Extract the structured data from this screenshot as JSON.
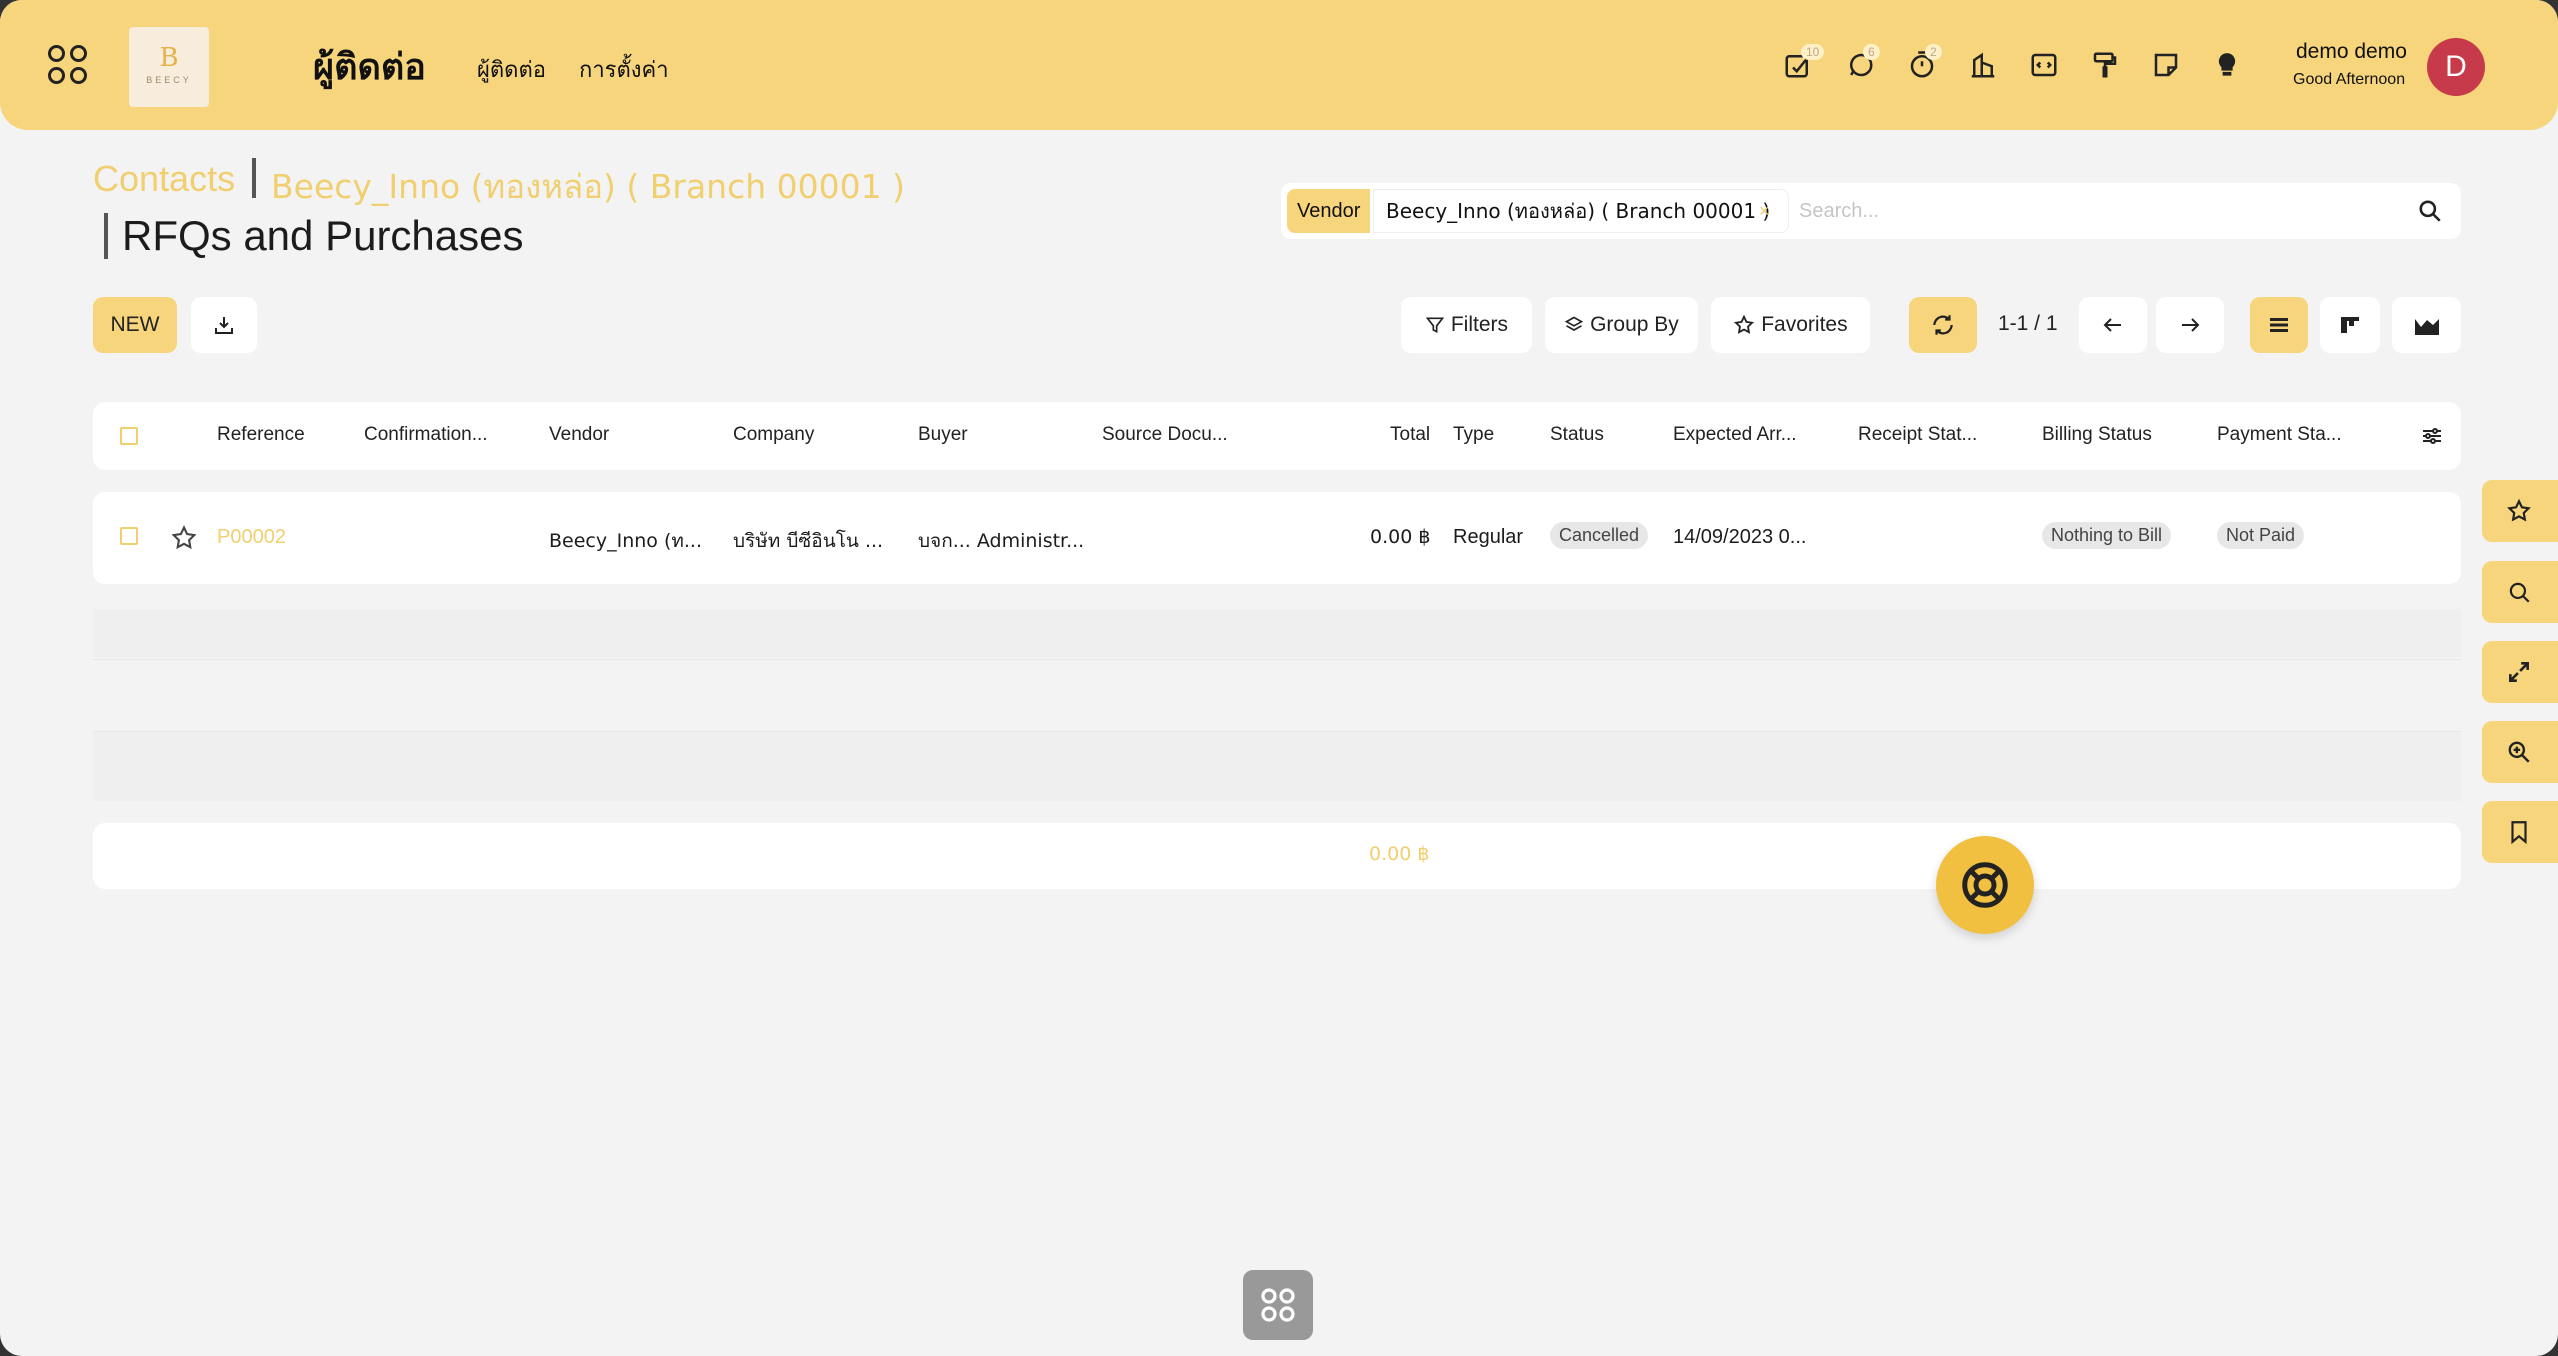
{
  "header": {
    "app_title": "ผู้ติดต่อ",
    "menu": [
      "ผู้ติดต่อ",
      "การตั้งค่า"
    ],
    "logo_text": "BEECY",
    "logo_letter": "B",
    "badges": {
      "activities": "10",
      "messages": "6",
      "timer": "2"
    },
    "user_name": "demo demo",
    "greeting": "Good Afternoon",
    "avatar_letter": "D"
  },
  "breadcrumb": {
    "contacts": "Contacts",
    "record": "Beecy_Inno (ทองหล่อ)  ( Branch 00001 )",
    "title": "RFQs and Purchases"
  },
  "search": {
    "facet_label": "Vendor",
    "facet_value": "Beecy_Inno (ทองหล่อ) ( Branch 00001 )",
    "facet_remove": "×",
    "placeholder": "Search..."
  },
  "toolbar": {
    "new_label": "NEW",
    "filters_label": "Filters",
    "group_by_label": "Group By",
    "favorites_label": "Favorites",
    "pager": "1-1 / 1"
  },
  "table": {
    "columns": [
      "Reference",
      "Confirmation...",
      "Vendor",
      "Company",
      "Buyer",
      "Source Docu...",
      "Total",
      "Type",
      "Status",
      "Expected Arr...",
      "Receipt Stat...",
      "Billing Status",
      "Payment Sta..."
    ],
    "rows": [
      {
        "reference": "P00002",
        "confirmation": "",
        "vendor": "Beecy_Inno (ท...",
        "company": "บริษัท บีซีอินโน ...",
        "buyer": "บจก... Administr...",
        "source": "",
        "total": "0.00 ฿",
        "type": "Regular",
        "status": "Cancelled",
        "expected": "14/09/2023 0...",
        "receipt": "",
        "billing": "Nothing to Bill",
        "payment": "Not Paid"
      }
    ],
    "footer_total": "0.00 ฿"
  },
  "colors": {
    "accent": "#f7d57c",
    "accent_text": "#f1cf6f",
    "avatar": "#c73a4b",
    "background": "#f3f3f3"
  }
}
